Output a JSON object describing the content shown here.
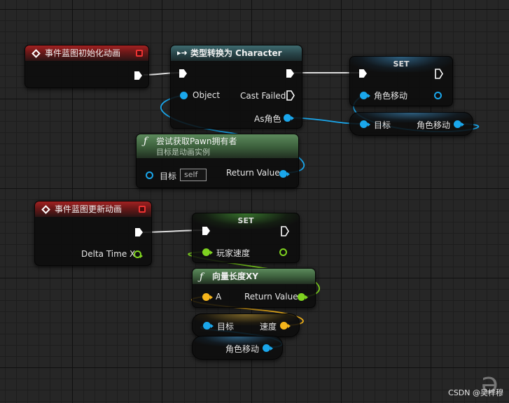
{
  "graph": {
    "nodes": {
      "event_init": {
        "title": "事件蓝图初始化动画"
      },
      "cast": {
        "title": "类型转换为 Character",
        "object_pin": "Object",
        "cast_failed_pin": "Cast Failed",
        "as_pin": "As角色"
      },
      "set_top": {
        "title": "SET",
        "var_pin": "角色移动"
      },
      "get_top": {
        "target_pin": "目标",
        "out_pin": "角色移动"
      },
      "try_get_pawn": {
        "title": "尝试获取Pawn拥有者",
        "subtitle": "目标是动画实例",
        "target_pin": "目标",
        "target_value": "self",
        "return_pin": "Return Value"
      },
      "event_update": {
        "title": "事件蓝图更新动画",
        "delta_pin": "Delta Time X"
      },
      "set_bottom": {
        "title": "SET",
        "var_pin": "玩家速度"
      },
      "vector_length": {
        "title": "向量长度XY",
        "a_pin": "A",
        "return_pin": "Return Value"
      },
      "get_velocity": {
        "target_pin": "目标",
        "out_pin": "速度"
      },
      "get_movement": {
        "out_pin": "角色移动"
      }
    }
  },
  "colors": {
    "exec": "#ffffff",
    "object_pin": "#1aa7ec",
    "float_pin": "#7fd320",
    "vector_pin": "#f5b51b",
    "event_header": "#a32222",
    "cast_header": "#3f6b70",
    "function_header": "#5c8a5c"
  },
  "icons": {
    "event": "diamond-arrow-icon",
    "cast": "cast-arrow-icon",
    "function": "function-f-icon",
    "delegate": "red-square-icon"
  },
  "watermark": "CSDN @吴梓穆"
}
